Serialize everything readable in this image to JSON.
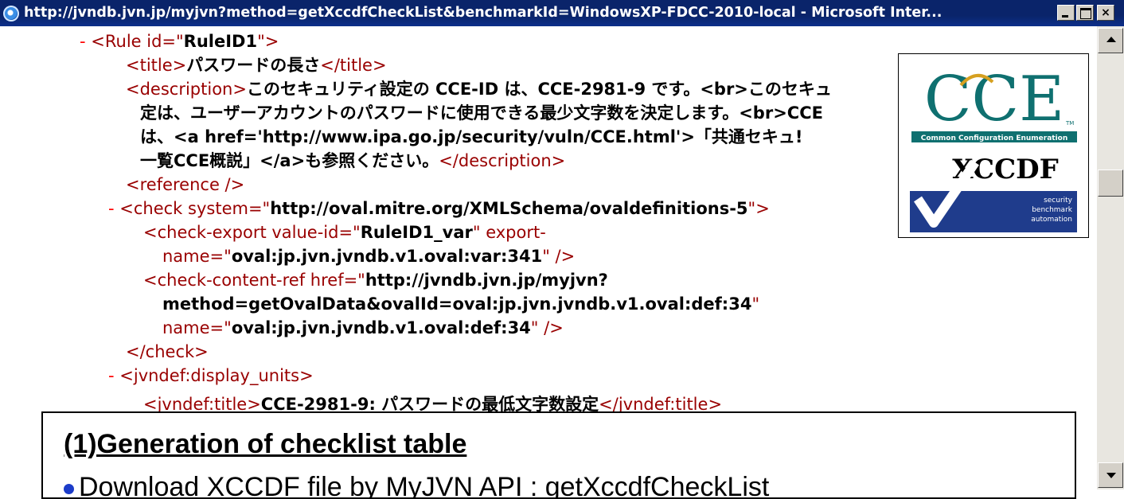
{
  "window": {
    "title": "http://jvndb.jvn.jp/myjvn?method=getXccdfCheckList&benchmarkId=WindowsXP-FDCC-2010-local - Microsoft Inter...",
    "min_label": "",
    "max_label": "",
    "close_label": "×"
  },
  "xml": {
    "l1": {
      "dash": "-",
      "open": "<Rule id=\"",
      "val": "RuleID1",
      "close": "\">"
    },
    "l2": {
      "open": "<title>",
      "text": "パスワードの長さ",
      "close": "</title>"
    },
    "l3": {
      "open": "<description>",
      "text": "このセキュリティ設定の CCE-ID は、CCE-2981-9 です。<br>このセキュ"
    },
    "l4": {
      "text": "定は、ユーザーアカウントのパスワードに使用できる最少文字数を決定します。<br>CCE"
    },
    "l5": {
      "text": "は、<a href='http://www.ipa.go.jp/security/vuln/CCE.html'>「共通セキュ!"
    },
    "l6": {
      "text": "一覧CCE概説」</a>も参照ください。",
      "close": "</description>"
    },
    "l7": {
      "tag": "<reference />"
    },
    "l8": {
      "dash": "-",
      "open": "<check system=\"",
      "val": "http://oval.mitre.org/XMLSchema/ovaldefinitions-5",
      "close": "\">"
    },
    "l9": {
      "open": "<check-export value-id=\"",
      "val": "RuleID1_var",
      "close": "\" export-"
    },
    "l10": {
      "open": "name=\"",
      "val": "oval:jp.jvn.jvndb.v1.oval:var:341",
      "close": "\" />"
    },
    "l11": {
      "open": "<check-content-ref href=\"",
      "val": "http://jvndb.jvn.jp/myjvn?"
    },
    "l12": {
      "val": "method=getOvalData&ovalId=oval:jp.jvn.jvndb.v1.oval:def:34",
      "close": "\""
    },
    "l13": {
      "open": "name=\"",
      "val": "oval:jp.jvn.jvndb.v1.oval:def:34",
      "close": "\" />"
    },
    "l14": {
      "tag": "</check>"
    },
    "l15": {
      "dash": "-",
      "tag": "<jvndef:display_units>"
    },
    "l16": {
      "open": "<jvndef:title>",
      "text": "CCE-2981-9: パスワードの最低文字数設定",
      "close": "</jvndef:title>"
    }
  },
  "logos": {
    "cce": {
      "letters": "CCE",
      "tm": "TM",
      "caption": "Common Configuration Enumeration"
    },
    "xccdf": {
      "name": "XCCDF",
      "tag1": "security",
      "tag2": "benchmark",
      "tag3": "automation"
    }
  },
  "overlay": {
    "title": "(1)Generation of checklist table",
    "bullet": "Download XCCDF file by MyJVN API : getXccdfCheckList"
  },
  "colors": {
    "titlebar": "#0a246a",
    "tag": "#990000",
    "cce_teal": "#0f7070",
    "cce_gold": "#d6a020",
    "xccdf_blue": "#1f3c8c",
    "bullet": "#1c3cc9"
  }
}
